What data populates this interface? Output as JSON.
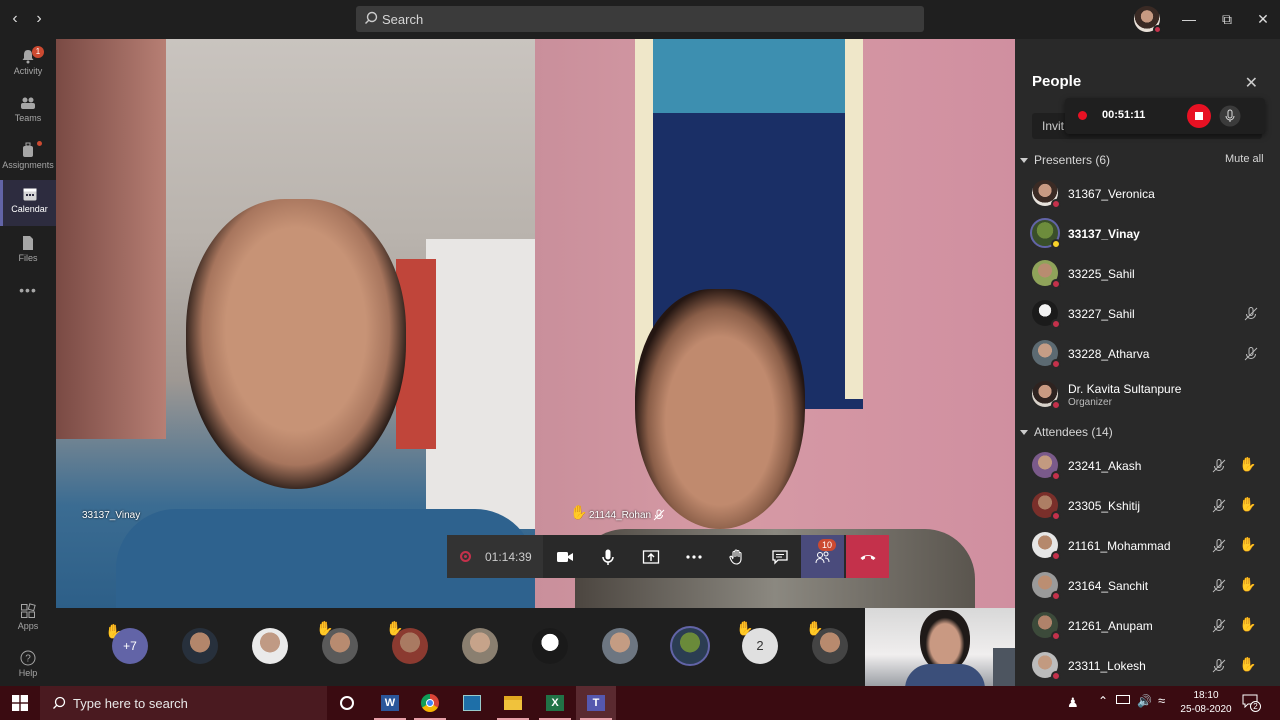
{
  "search": {
    "placeholder": "Search"
  },
  "rail": {
    "items": [
      {
        "label": "Activity",
        "icon": "bell-icon",
        "badge": "1"
      },
      {
        "label": "Teams",
        "icon": "teams-icon"
      },
      {
        "label": "Assignments",
        "icon": "backpack-icon"
      },
      {
        "label": "Calendar",
        "icon": "calendar-icon"
      },
      {
        "label": "Files",
        "icon": "file-icon"
      },
      {
        "label": "Apps",
        "icon": "apps-icon"
      },
      {
        "label": "Help",
        "icon": "help-icon"
      }
    ]
  },
  "stage": {
    "left_name": "33137_Vinay",
    "right_name": "21144_Rohan"
  },
  "calltools": {
    "timer": "01:14:39",
    "participants_badge": "10"
  },
  "roster": {
    "overflow": "+7",
    "count_bubble": "2"
  },
  "people": {
    "title": "People",
    "invite_label": "Invit",
    "recording_time": "00:51:11",
    "presenters_header": "Presenters (6)",
    "mute_all": "Mute all",
    "presenters": [
      {
        "name": "31367_Veronica"
      },
      {
        "name": "33137_Vinay"
      },
      {
        "name": "33225_Sahil"
      },
      {
        "name": "33227_Sahil"
      },
      {
        "name": "33228_Atharva"
      },
      {
        "name": "Dr. Kavita Sultanpure",
        "role": "Organizer"
      }
    ],
    "attendees_header": "Attendees (14)",
    "attendees": [
      {
        "name": "23241_Akash"
      },
      {
        "name": "23305_Kshitij"
      },
      {
        "name": "21161_Mohammad"
      },
      {
        "name": "23164_Sanchit"
      },
      {
        "name": "21261_Anupam"
      },
      {
        "name": "23311_Lokesh"
      }
    ]
  },
  "taskbar": {
    "search_placeholder": "Type here to search",
    "time": "18:10",
    "date": "25-08-2020",
    "notification_count": "2"
  },
  "colors": {
    "accent": "#6264a7",
    "hangup": "#c4314b",
    "hand": "#f2b80f",
    "taskbar": "#3a0b11"
  }
}
